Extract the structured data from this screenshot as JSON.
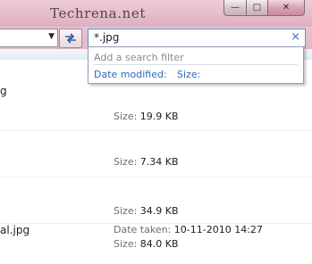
{
  "window": {
    "watermark": "Techrena.net",
    "controls": {
      "minimize": "—",
      "maximize": "□",
      "close": "✕"
    }
  },
  "address_bar": {
    "dropdown_glyph": "▼",
    "refresh_icon": "refresh-arrows-icon"
  },
  "search": {
    "value": "*.jpg",
    "clear_glyph": "×",
    "accent_color": "#2d6bb3"
  },
  "search_dropdown": {
    "header": "Add a search filter",
    "filters": [
      {
        "label": "Date modified:"
      },
      {
        "label": "Size:"
      }
    ]
  },
  "files": [
    {
      "name": "g",
      "props": [
        {
          "label": "Size:",
          "value": "19.9 KB"
        }
      ]
    },
    {
      "name": "",
      "props": [
        {
          "label": "Size:",
          "value": "7.34 KB"
        }
      ]
    },
    {
      "name": "",
      "props": [
        {
          "label": "Size:",
          "value": "34.9 KB"
        }
      ]
    },
    {
      "name": "al.jpg",
      "props": [
        {
          "label": "Date taken:",
          "value": "10-11-2010 14:27"
        },
        {
          "label": "Size:",
          "value": "84.0 KB"
        }
      ]
    }
  ]
}
